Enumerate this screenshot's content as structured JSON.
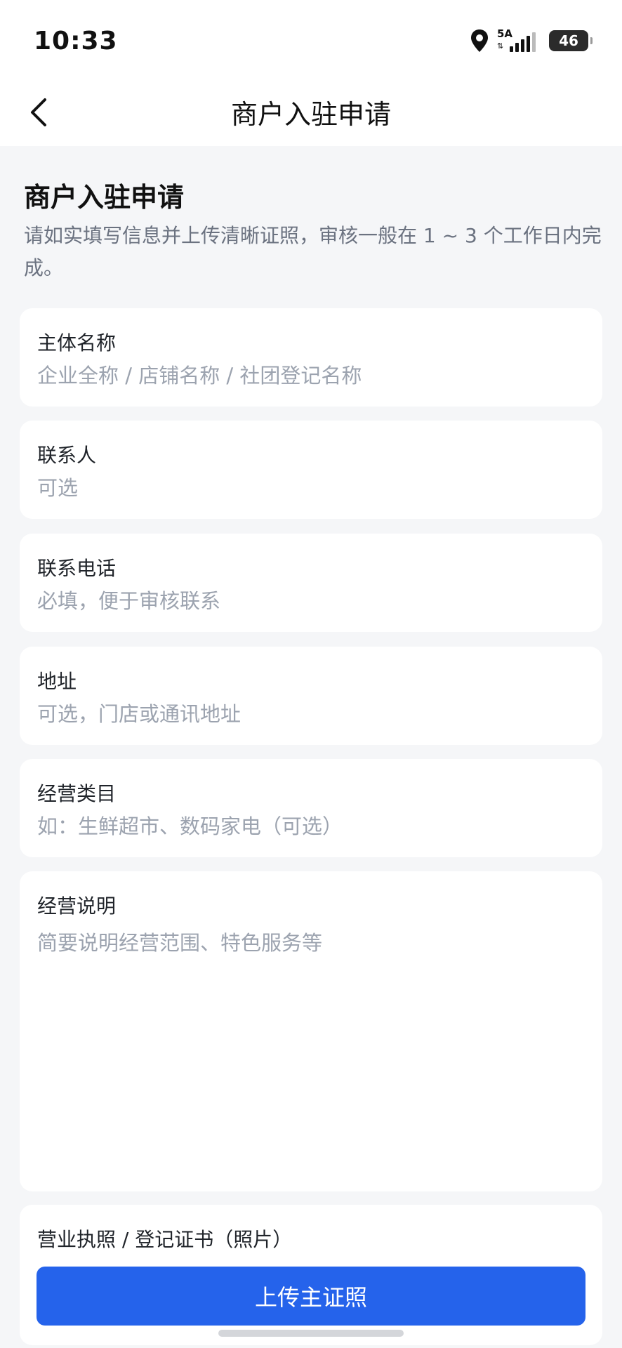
{
  "status_bar": {
    "time": "10:33",
    "network": "5A",
    "network_arrows": "⇅",
    "battery": "46"
  },
  "nav": {
    "title": "商户入驻申请",
    "back_icon": "chevron-left-icon"
  },
  "page": {
    "heading": "商户入驻申请",
    "description": "请如实填写信息并上传清晰证照，审核一般在 1 ~ 3 个工作日内完成。"
  },
  "form": {
    "entity_name": {
      "label": "主体名称",
      "placeholder": "企业全称 / 店铺名称 / 社团登记名称"
    },
    "contact_person": {
      "label": "联系人",
      "placeholder": "可选"
    },
    "contact_phone": {
      "label": "联系电话",
      "placeholder": "必填，便于审核联系"
    },
    "address": {
      "label": "地址",
      "placeholder": "可选，门店或通讯地址"
    },
    "business_category": {
      "label": "经营类目",
      "placeholder": "如：生鲜超市、数码家电（可选）"
    },
    "business_description": {
      "label": "经营说明",
      "placeholder": "简要说明经营范围、特色服务等"
    },
    "license": {
      "label": "营业执照 / 登记证书（照片）",
      "upload_button": "上传主证照"
    }
  },
  "colors": {
    "accent": "#2563eb",
    "background": "#f5f6f8",
    "card": "#ffffff",
    "placeholder": "#9ca3af"
  }
}
